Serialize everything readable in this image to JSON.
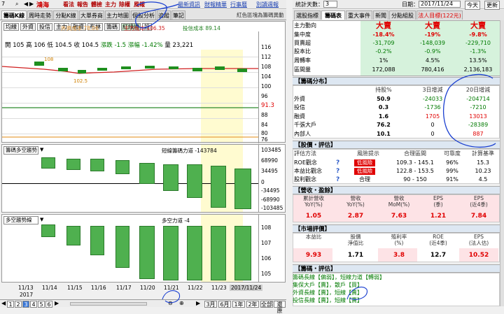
{
  "topbar": {
    "stock_code": "7",
    "stock_name": "鴻海",
    "buttons": [
      "看法",
      "報告",
      "體檢",
      "主力",
      "除權",
      "風報"
    ],
    "links": [
      "最新資訊",
      "財報精華",
      "行事曆",
      "別讀週報"
    ]
  },
  "tabs": [
    "籌碼K線",
    "周時走勢",
    "分點K線",
    "大單券商",
    "主力地圖",
    "個股分析",
    "追蹤",
    "筆記"
  ],
  "tabs_right_note": "紅色區塊為籌碼異動",
  "toolbar": [
    "均線",
    "外資",
    "投信",
    "主力",
    "融資",
    "布林",
    "籌碼",
    "紅綠燈",
    "設"
  ],
  "legend": {
    "foreign": "外資成本 78.06",
    "main": "主力成本 106.35",
    "trust": "投信成本 89.14"
  },
  "ohlc": {
    "open": "開 105",
    "high": "高 106",
    "low": "低 104.5",
    "close": "收 104.5",
    "change": "漲跌 -1.5",
    "pct": "漲幅 -1.42%",
    "volume": "量 23,221"
  },
  "price_chart": {
    "y_labels": [
      "116",
      "112",
      "108",
      "104",
      "100",
      "96",
      "91.3",
      "88",
      "84",
      "80",
      "76"
    ],
    "annot_high": "108",
    "annot_low": "102.5"
  },
  "panel2": {
    "title": "籌碼多空趨勢",
    "legend": "短線籌碼力道 -143784",
    "y_labels": [
      "103485",
      "68990",
      "34495",
      "0",
      "-34495",
      "-68990",
      "-103485"
    ]
  },
  "panel3": {
    "title": "多空趨勢線",
    "legend": "多空力道 -4",
    "y_labels": [
      "108",
      "107",
      "106",
      "105"
    ]
  },
  "x_labels": [
    "11/13",
    "11/14",
    "11/15",
    "11/16",
    "11/17",
    "11/20",
    "11/21",
    "11/22",
    "11/23",
    "2017/11/24"
  ],
  "x_year": "2017",
  "bottom": {
    "pages": [
      "1",
      "2",
      "3",
      "4",
      "5",
      "6"
    ],
    "ranges": [
      "3月",
      "6月",
      "1年",
      "2年",
      "全部",
      "還原"
    ]
  },
  "right": {
    "top_label": "統計天數：",
    "days": "3",
    "date_label": "日期：",
    "date": "2017/11/24",
    "today": "今天",
    "refresh": "更新",
    "tabs": [
      "選股指標",
      "籌碼表",
      "重大事件",
      "新聞",
      "分點組股",
      "法人目標(122元)"
    ],
    "summary_rows": [
      {
        "label": "主力動向",
        "v": [
          "大賣",
          "大賣",
          "大賣"
        ]
      },
      {
        "label": "集中度",
        "v": [
          "-18.4%",
          "-19%",
          "-9.8%"
        ]
      },
      {
        "label": "買賣超",
        "v": [
          "-31,709",
          "-148,039",
          "-229,710"
        ]
      },
      {
        "label": "股本比",
        "v": [
          "-0.2%",
          "-0.9%",
          "-1.3%"
        ]
      },
      {
        "label": "周轉率",
        "v": [
          "1%",
          "4.5%",
          "13.5%"
        ]
      },
      {
        "label": "區間量",
        "v": [
          "172,088",
          "780,416",
          "2,136,183"
        ]
      }
    ],
    "dist_title": "【籌碼分布】",
    "dist_header": [
      "持股%",
      "3日增減",
      "20日增減"
    ],
    "dist_rows": [
      {
        "label": "外資",
        "v": [
          "50.9",
          "-24033",
          "-204714"
        ]
      },
      {
        "label": "投信",
        "v": [
          "0.3",
          "-1736",
          "-7210"
        ]
      },
      {
        "label": "融資",
        "v": [
          "1.6",
          "1705",
          "13013"
        ]
      },
      {
        "label": "千張大戶",
        "v": [
          "76.2",
          "0",
          "-28389"
        ]
      },
      {
        "label": "內部人",
        "v": [
          "10.1",
          "0",
          "887"
        ]
      }
    ],
    "val_title": "【股價・評估】",
    "val_header": [
      "評估方法",
      "風險提示",
      "合理區間",
      "可靠度",
      "計算基準"
    ],
    "val_rows": [
      {
        "label": "ROE觀念",
        "risk": "低風險",
        "range": "109.3 - 145.1",
        "rel": "96%",
        "base": "15.3"
      },
      {
        "label": "本益比觀念",
        "risk": "低風險",
        "range": "122.8 - 153.5",
        "rel": "99%",
        "base": "10.23"
      },
      {
        "label": "股利觀念",
        "risk": "合理",
        "range": "90 - 150",
        "rel": "91%",
        "base": "4.5"
      }
    ],
    "rev_title": "【營收・盈餘】",
    "rev_header": [
      "累計營收\nYoY(%)",
      "營收\nYoY(%)",
      "營收\nMoM(%)",
      "EPS\n(季)",
      "EPS\n(近4季)"
    ],
    "rev_values": [
      "1.05",
      "2.87",
      "7.63",
      "1.21",
      "7.84"
    ],
    "mkt_title": "【市場評價】",
    "mkt_header": [
      "本益比",
      "股價\n淨值比",
      "殖利率\n(%)",
      "ROE\n(近4季)",
      "EPS\n(法人估)"
    ],
    "mkt_values": [
      "9.93",
      "1.71",
      "3.8",
      "12.7",
      "10.52"
    ],
    "chip_title": "【籌碼・評估】",
    "chip_lines": [
      "籌碼長線【偏弱】，短線力道【轉弱】",
      "集保大戶【賣】，散戶【買】",
      "外資長線【賣】，短線【賣】",
      "投信長線【賣】，短線【賣】"
    ]
  },
  "colors": {
    "accent_red": "#e00000",
    "accent_green": "#007a00",
    "bar_green": "#1f8f1f",
    "ink_blue": "#1a3fd0"
  }
}
